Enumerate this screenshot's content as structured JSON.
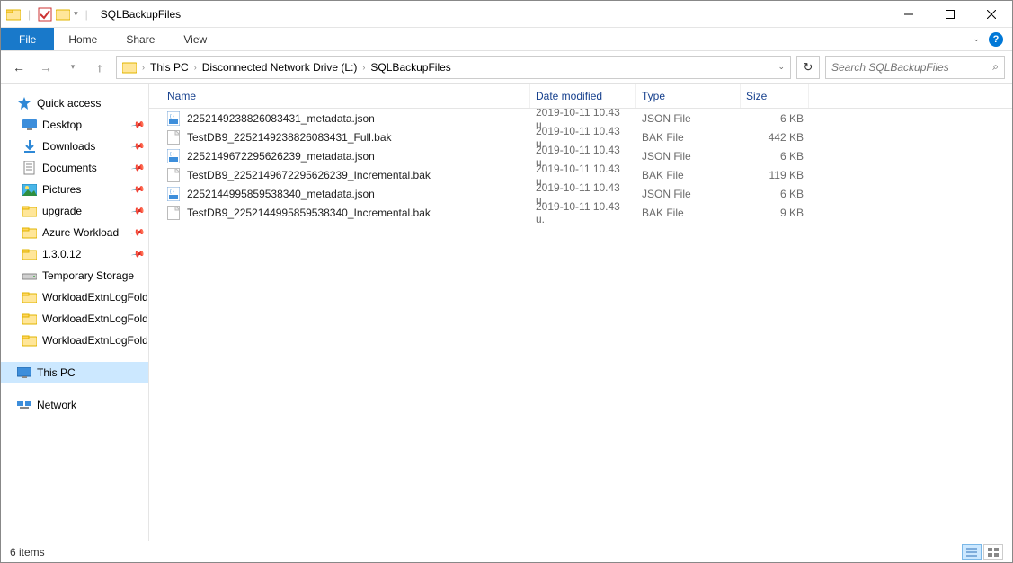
{
  "window": {
    "title": "SQLBackupFiles"
  },
  "ribbon": {
    "file": "File",
    "tabs": [
      "Home",
      "Share",
      "View"
    ]
  },
  "breadcrumb": [
    "This PC",
    "Disconnected Network Drive (L:)",
    "SQLBackupFiles"
  ],
  "search": {
    "placeholder": "Search SQLBackupFiles"
  },
  "nav": {
    "quick_access": "Quick access",
    "quick_items": [
      {
        "label": "Desktop",
        "icon": "desktop",
        "pinned": true
      },
      {
        "label": "Downloads",
        "icon": "downloads",
        "pinned": true
      },
      {
        "label": "Documents",
        "icon": "documents",
        "pinned": true
      },
      {
        "label": "Pictures",
        "icon": "pictures",
        "pinned": true
      },
      {
        "label": "upgrade",
        "icon": "folder",
        "pinned": true
      },
      {
        "label": "Azure Workload",
        "icon": "folder",
        "pinned": true
      },
      {
        "label": "1.3.0.12",
        "icon": "folder",
        "pinned": true
      },
      {
        "label": "Temporary Storage",
        "icon": "drive",
        "pinned": false
      },
      {
        "label": "WorkloadExtnLogFolder",
        "icon": "folder",
        "pinned": false
      },
      {
        "label": "WorkloadExtnLogFolder",
        "icon": "folder",
        "pinned": false
      },
      {
        "label": "WorkloadExtnLogFolder",
        "icon": "folder",
        "pinned": false
      }
    ],
    "this_pc": "This PC",
    "network": "Network"
  },
  "columns": {
    "name": "Name",
    "date": "Date modified",
    "type": "Type",
    "size": "Size"
  },
  "files": [
    {
      "name": "2252149238826083431_metadata.json",
      "date": "2019-10-11 10.43 u.",
      "type": "JSON File",
      "size": "6 KB",
      "icon": "json"
    },
    {
      "name": "TestDB9_2252149238826083431_Full.bak",
      "date": "2019-10-11 10.43 u.",
      "type": "BAK File",
      "size": "442 KB",
      "icon": "blank"
    },
    {
      "name": "2252149672295626239_metadata.json",
      "date": "2019-10-11 10.43 u.",
      "type": "JSON File",
      "size": "6 KB",
      "icon": "json"
    },
    {
      "name": "TestDB9_2252149672295626239_Incremental.bak",
      "date": "2019-10-11 10.43 u.",
      "type": "BAK File",
      "size": "119 KB",
      "icon": "blank"
    },
    {
      "name": "2252144995859538340_metadata.json",
      "date": "2019-10-11 10.43 u.",
      "type": "JSON File",
      "size": "6 KB",
      "icon": "json"
    },
    {
      "name": "TestDB9_2252144995859538340_Incremental.bak",
      "date": "2019-10-11 10.43 u.",
      "type": "BAK File",
      "size": "9 KB",
      "icon": "blank"
    }
  ],
  "status": {
    "text": "6 items"
  }
}
